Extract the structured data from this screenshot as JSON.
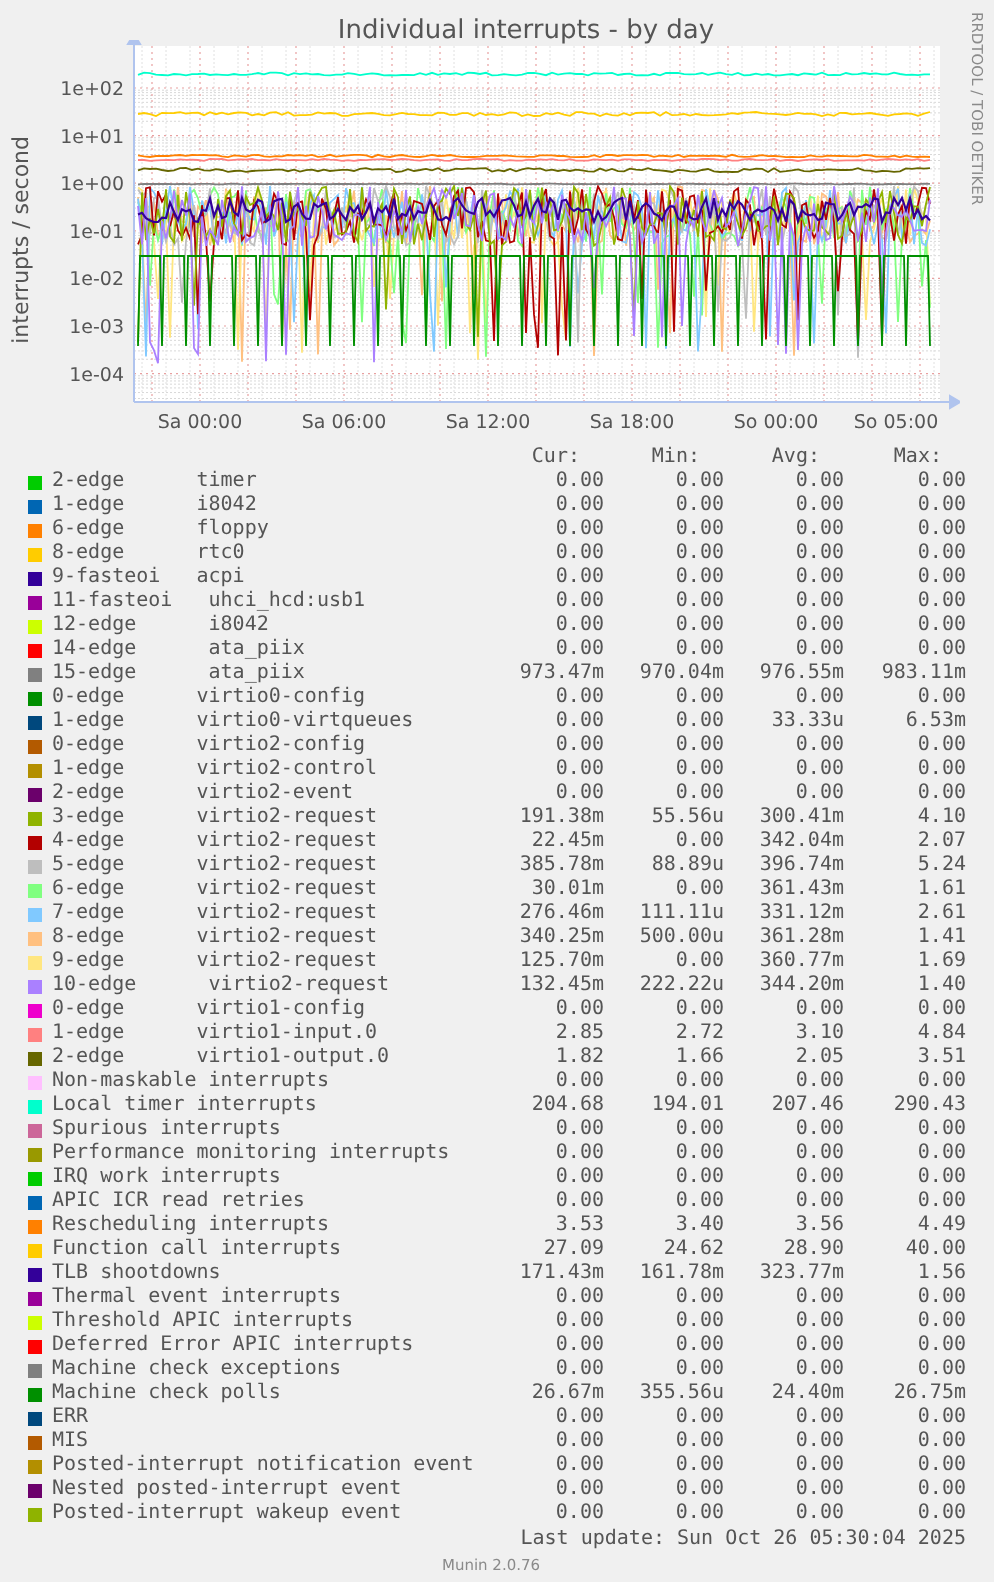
{
  "title": "Individual interrupts - by day",
  "y_axis_title": "interrupts / second",
  "credit": "RRDTOOL / TOBI OETIKER",
  "y_axis_labels": [
    "1e+02",
    "1e+01",
    "1e+00",
    "1e-01",
    "1e-02",
    "1e-03",
    "1e-04"
  ],
  "x_axis_labels": [
    "Sa 00:00",
    "Sa 06:00",
    "Sa 12:00",
    "Sa 18:00",
    "So 00:00",
    "So 05:00"
  ],
  "legend": {
    "columns": [
      "Cur:",
      "Min:",
      "Avg:",
      "Max:"
    ],
    "rows": [
      {
        "label": "2-edge      timer",
        "color": "#00cc00",
        "cur": "0.00",
        "min": "0.00",
        "avg": "0.00",
        "max": "0.00"
      },
      {
        "label": "1-edge      i8042",
        "color": "#0066b3",
        "cur": "0.00",
        "min": "0.00",
        "avg": "0.00",
        "max": "0.00"
      },
      {
        "label": "6-edge      floppy",
        "color": "#ff8000",
        "cur": "0.00",
        "min": "0.00",
        "avg": "0.00",
        "max": "0.00"
      },
      {
        "label": "8-edge      rtc0",
        "color": "#ffcc00",
        "cur": "0.00",
        "min": "0.00",
        "avg": "0.00",
        "max": "0.00"
      },
      {
        "label": "9-fasteoi   acpi",
        "color": "#330099",
        "cur": "0.00",
        "min": "0.00",
        "avg": "0.00",
        "max": "0.00"
      },
      {
        "label": "11-fasteoi   uhci_hcd:usb1",
        "color": "#990099",
        "cur": "0.00",
        "min": "0.00",
        "avg": "0.00",
        "max": "0.00"
      },
      {
        "label": "12-edge      i8042",
        "color": "#ccff00",
        "cur": "0.00",
        "min": "0.00",
        "avg": "0.00",
        "max": "0.00"
      },
      {
        "label": "14-edge      ata_piix",
        "color": "#ff0000",
        "cur": "0.00",
        "min": "0.00",
        "avg": "0.00",
        "max": "0.00"
      },
      {
        "label": "15-edge      ata_piix",
        "color": "#808080",
        "cur": "973.47m",
        "min": "970.04m",
        "avg": "976.55m",
        "max": "983.11m"
      },
      {
        "label": "0-edge      virtio0-config",
        "color": "#008f00",
        "cur": "0.00",
        "min": "0.00",
        "avg": "0.00",
        "max": "0.00"
      },
      {
        "label": "1-edge      virtio0-virtqueues",
        "color": "#00487d",
        "cur": "0.00",
        "min": "0.00",
        "avg": "33.33u",
        "max": "6.53m"
      },
      {
        "label": "0-edge      virtio2-config",
        "color": "#b35a00",
        "cur": "0.00",
        "min": "0.00",
        "avg": "0.00",
        "max": "0.00"
      },
      {
        "label": "1-edge      virtio2-control",
        "color": "#b38f00",
        "cur": "0.00",
        "min": "0.00",
        "avg": "0.00",
        "max": "0.00"
      },
      {
        "label": "2-edge      virtio2-event",
        "color": "#6b006b",
        "cur": "0.00",
        "min": "0.00",
        "avg": "0.00",
        "max": "0.00"
      },
      {
        "label": "3-edge      virtio2-request",
        "color": "#8fb300",
        "cur": "191.38m",
        "min": "55.56u",
        "avg": "300.41m",
        "max": "4.10"
      },
      {
        "label": "4-edge      virtio2-request",
        "color": "#b30000",
        "cur": "22.45m",
        "min": "0.00",
        "avg": "342.04m",
        "max": "2.07"
      },
      {
        "label": "5-edge      virtio2-request",
        "color": "#bebebe",
        "cur": "385.78m",
        "min": "88.89u",
        "avg": "396.74m",
        "max": "5.24"
      },
      {
        "label": "6-edge      virtio2-request",
        "color": "#80ff80",
        "cur": "30.01m",
        "min": "0.00",
        "avg": "361.43m",
        "max": "1.61"
      },
      {
        "label": "7-edge      virtio2-request",
        "color": "#80c9ff",
        "cur": "276.46m",
        "min": "111.11u",
        "avg": "331.12m",
        "max": "2.61"
      },
      {
        "label": "8-edge      virtio2-request",
        "color": "#ffc080",
        "cur": "340.25m",
        "min": "500.00u",
        "avg": "361.28m",
        "max": "1.41"
      },
      {
        "label": "9-edge      virtio2-request",
        "color": "#ffe680",
        "cur": "125.70m",
        "min": "0.00",
        "avg": "360.77m",
        "max": "1.69"
      },
      {
        "label": "10-edge      virtio2-request",
        "color": "#aa80ff",
        "cur": "132.45m",
        "min": "222.22u",
        "avg": "344.20m",
        "max": "1.40"
      },
      {
        "label": "0-edge      virtio1-config",
        "color": "#ee00cc",
        "cur": "0.00",
        "min": "0.00",
        "avg": "0.00",
        "max": "0.00"
      },
      {
        "label": "1-edge      virtio1-input.0",
        "color": "#ff8080",
        "cur": "2.85",
        "min": "2.72",
        "avg": "3.10",
        "max": "4.84"
      },
      {
        "label": "2-edge      virtio1-output.0",
        "color": "#666600",
        "cur": "1.82",
        "min": "1.66",
        "avg": "2.05",
        "max": "3.51"
      },
      {
        "label": "Non-maskable interrupts",
        "color": "#ffbfff",
        "cur": "0.00",
        "min": "0.00",
        "avg": "0.00",
        "max": "0.00"
      },
      {
        "label": "Local timer interrupts",
        "color": "#00ffcc",
        "cur": "204.68",
        "min": "194.01",
        "avg": "207.46",
        "max": "290.43"
      },
      {
        "label": "Spurious interrupts",
        "color": "#cc6699",
        "cur": "0.00",
        "min": "0.00",
        "avg": "0.00",
        "max": "0.00"
      },
      {
        "label": "Performance monitoring interrupts",
        "color": "#999900",
        "cur": "0.00",
        "min": "0.00",
        "avg": "0.00",
        "max": "0.00"
      },
      {
        "label": "IRQ work interrupts",
        "color": "#00cc00",
        "cur": "0.00",
        "min": "0.00",
        "avg": "0.00",
        "max": "0.00"
      },
      {
        "label": "APIC ICR read retries",
        "color": "#0066b3",
        "cur": "0.00",
        "min": "0.00",
        "avg": "0.00",
        "max": "0.00"
      },
      {
        "label": "Rescheduling interrupts",
        "color": "#ff8000",
        "cur": "3.53",
        "min": "3.40",
        "avg": "3.56",
        "max": "4.49"
      },
      {
        "label": "Function call interrupts",
        "color": "#ffcc00",
        "cur": "27.09",
        "min": "24.62",
        "avg": "28.90",
        "max": "40.00"
      },
      {
        "label": "TLB shootdowns",
        "color": "#330099",
        "cur": "171.43m",
        "min": "161.78m",
        "avg": "323.77m",
        "max": "1.56"
      },
      {
        "label": "Thermal event interrupts",
        "color": "#990099",
        "cur": "0.00",
        "min": "0.00",
        "avg": "0.00",
        "max": "0.00"
      },
      {
        "label": "Threshold APIC interrupts",
        "color": "#ccff00",
        "cur": "0.00",
        "min": "0.00",
        "avg": "0.00",
        "max": "0.00"
      },
      {
        "label": "Deferred Error APIC interrupts",
        "color": "#ff0000",
        "cur": "0.00",
        "min": "0.00",
        "avg": "0.00",
        "max": "0.00"
      },
      {
        "label": "Machine check exceptions",
        "color": "#808080",
        "cur": "0.00",
        "min": "0.00",
        "avg": "0.00",
        "max": "0.00"
      },
      {
        "label": "Machine check polls",
        "color": "#008f00",
        "cur": "26.67m",
        "min": "355.56u",
        "avg": "24.40m",
        "max": "26.75m"
      },
      {
        "label": "ERR",
        "color": "#00487d",
        "cur": "0.00",
        "min": "0.00",
        "avg": "0.00",
        "max": "0.00"
      },
      {
        "label": "MIS",
        "color": "#b35a00",
        "cur": "0.00",
        "min": "0.00",
        "avg": "0.00",
        "max": "0.00"
      },
      {
        "label": "Posted-interrupt notification event",
        "color": "#b38f00",
        "cur": "0.00",
        "min": "0.00",
        "avg": "0.00",
        "max": "0.00"
      },
      {
        "label": "Nested posted-interrupt event",
        "color": "#6b006b",
        "cur": "0.00",
        "min": "0.00",
        "avg": "0.00",
        "max": "0.00"
      },
      {
        "label": "Posted-interrupt wakeup event",
        "color": "#8fb300",
        "cur": "0.00",
        "min": "0.00",
        "avg": "0.00",
        "max": "0.00"
      }
    ]
  },
  "last_update": "Last update: Sun Oct 26 05:30:04 2025",
  "version": "Munin 2.0.76"
}
